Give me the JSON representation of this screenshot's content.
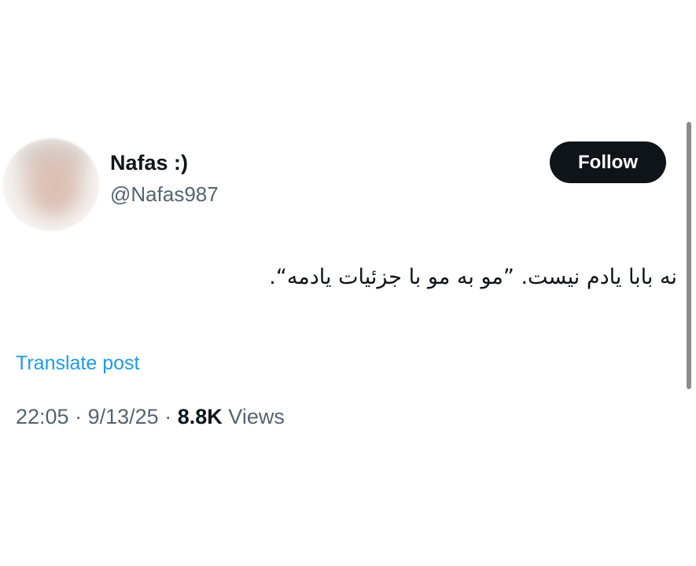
{
  "tweet": {
    "display_name": "Nafas :)",
    "handle": "@Nafas987",
    "follow_label": "Follow",
    "text": "نه بابا یادم نیست. ”مو به مو با جزئیات یادمه“.",
    "translate_label": "Translate post",
    "time": "22:05",
    "separator": "·",
    "date": "9/13/25",
    "views_count": "8.8K",
    "views_label": "Views"
  },
  "colors": {
    "text": "#0f1419",
    "secondary": "#536471",
    "link": "#1d9bf0",
    "button_bg": "#0f1419",
    "button_text": "#ffffff"
  }
}
